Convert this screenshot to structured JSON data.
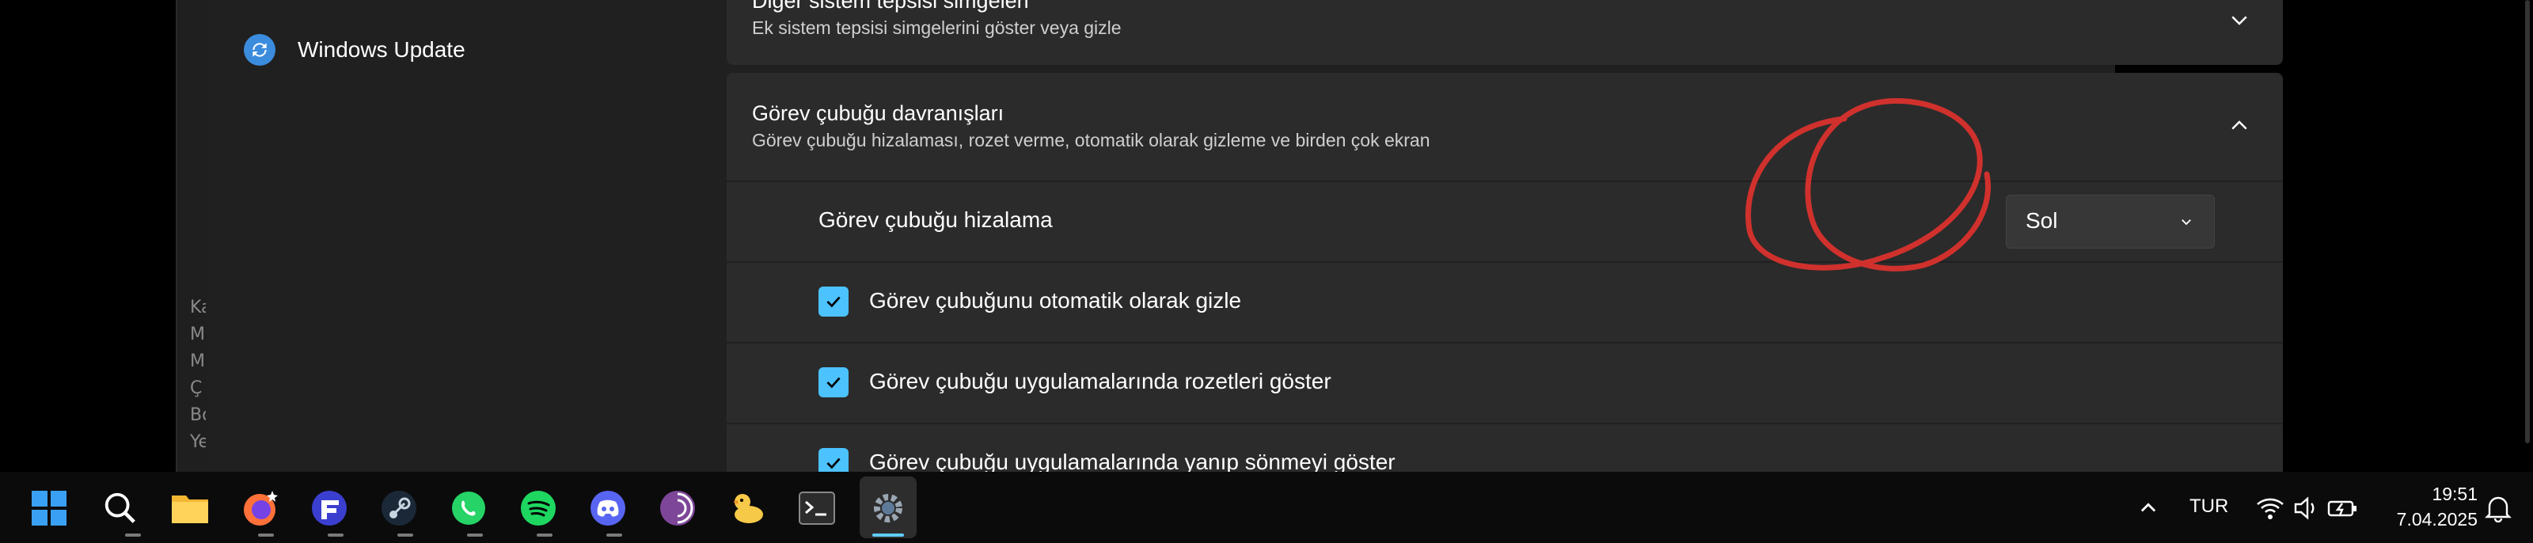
{
  "background_window": {
    "text_fragments": [
      "Ka",
      "M",
      "M",
      "Ç",
      "Bo",
      "Ye"
    ]
  },
  "sidebar": {
    "item_label": "Windows Update",
    "item_icon": "sync-icon"
  },
  "cards": {
    "other_tray_title": "Diğer sistem tepsisi simgeleri",
    "other_tray_subtitle": "Ek sistem tepsisi simgelerini göster veya gizle",
    "behaviors_title": "Görev çubuğu davranışları",
    "behaviors_subtitle": "Görev çubuğu hizalaması, rozet verme, otomatik olarak gizleme ve birden çok ekran"
  },
  "settings": {
    "alignment_label": "Görev çubuğu hizalama",
    "alignment_value": "Sol",
    "autohide_label": "Görev çubuğunu otomatik olarak gizle",
    "autohide_checked": true,
    "badges_label": "Görev çubuğu uygulamalarında rozetleri göster",
    "badges_checked": true,
    "flash_label": "Görev çubuğu uygulamalarında yanıp sönmeyi göster",
    "flash_checked": true
  },
  "taskbar": {
    "icons": [
      "windows-start-icon",
      "search-icon",
      "file-explorer-icon",
      "firefox-icon",
      "app-f-icon",
      "steam-icon",
      "whatsapp-icon",
      "spotify-icon",
      "discord-icon",
      "tor-browser-icon",
      "duck-app-icon",
      "terminal-icon",
      "settings-icon"
    ],
    "active_app": "settings-icon",
    "language": "TUR",
    "time": "19:51",
    "date": "7.04.2025"
  },
  "colors": {
    "accent": "#4cc2ff",
    "annotation": "#d0312d",
    "window_bg": "#202020",
    "card_bg": "#2b2b2b"
  }
}
